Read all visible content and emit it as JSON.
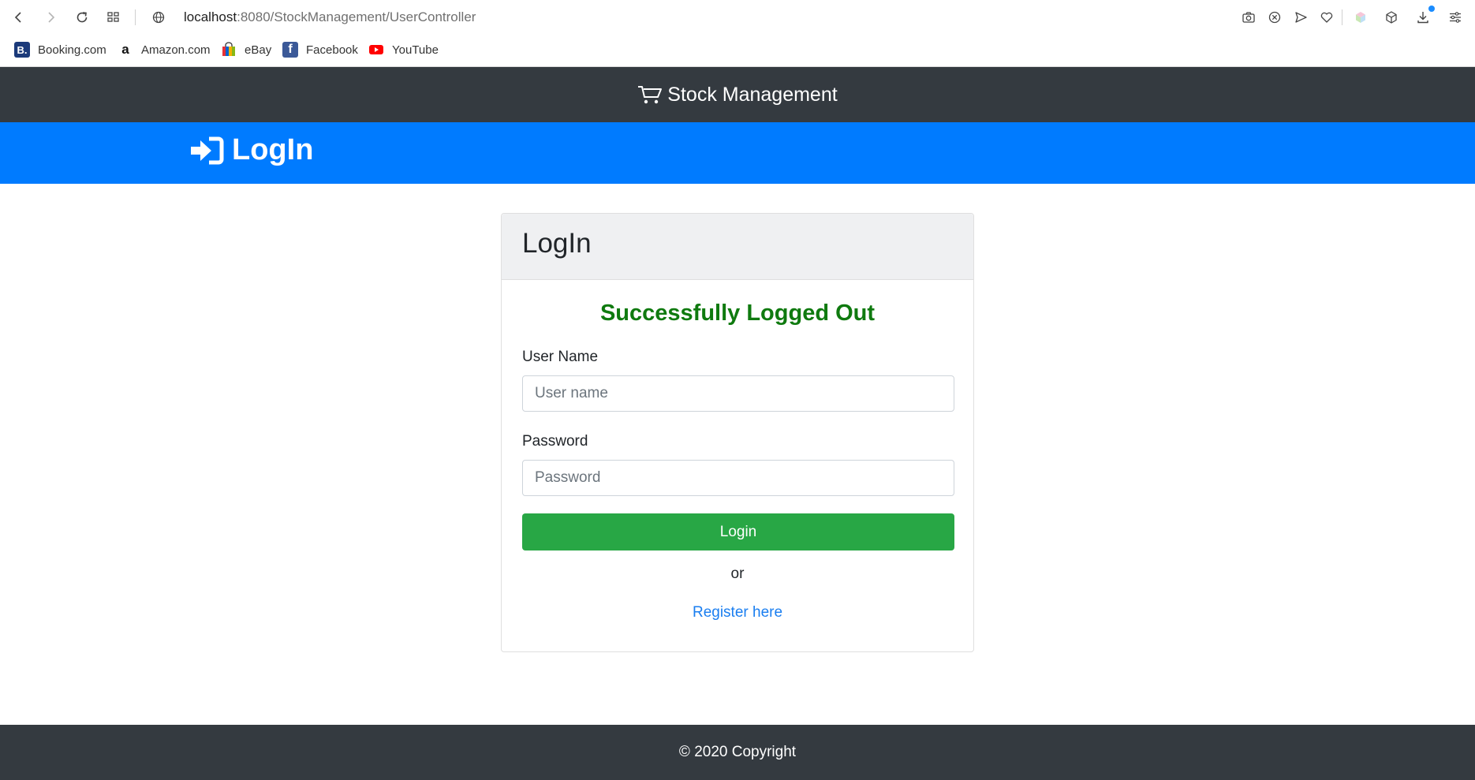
{
  "browser": {
    "url_host": "localhost",
    "url_path": ":8080/StockManagement/UserController",
    "bookmarks": [
      {
        "label": "Booking.com",
        "icon": "booking-icon"
      },
      {
        "label": "Amazon.com",
        "icon": "amazon-icon"
      },
      {
        "label": "eBay",
        "icon": "ebay-icon"
      },
      {
        "label": "Facebook",
        "icon": "facebook-icon"
      },
      {
        "label": "YouTube",
        "icon": "youtube-icon"
      }
    ]
  },
  "navbar": {
    "brand": "Stock Management",
    "icon": "cart-icon"
  },
  "jumbotron": {
    "title": "LogIn",
    "icon": "sign-in-icon"
  },
  "card": {
    "title": "LogIn",
    "message": "Successfully Logged Out",
    "username_label": "User Name",
    "username_placeholder": "User name",
    "username_value": "",
    "password_label": "Password",
    "password_placeholder": "Password",
    "password_value": "",
    "login_button": "Login",
    "or_text": "or",
    "register_link": "Register here"
  },
  "footer": {
    "text": "© 2020 Copyright"
  },
  "colors": {
    "navbar_bg": "#343a40",
    "jumbotron_bg": "#007bff",
    "success_text": "#0f7a0f",
    "login_button_bg": "#28a745",
    "link": "#1a7ef0"
  }
}
